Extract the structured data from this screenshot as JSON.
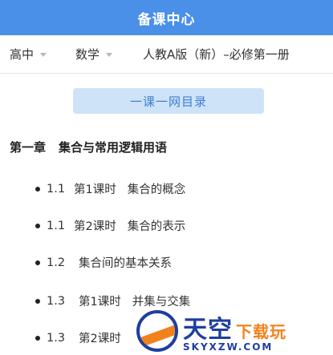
{
  "header": {
    "title": "备课中心"
  },
  "filters": {
    "level": "高中",
    "subject": "数学",
    "textbook": "人教A版（新）–必修第一册"
  },
  "catalog_button": {
    "label": "一课一网目录"
  },
  "chapter": {
    "number": "第一章",
    "title": "集合与常用逻辑用语"
  },
  "lessons": [
    {
      "number": "1.1",
      "period": "第1课时",
      "title": "集合的概念"
    },
    {
      "number": "1.1",
      "period": "第2课时",
      "title": "集合的表示"
    },
    {
      "number": "1.2",
      "period": "",
      "title": "集合间的基本关系"
    },
    {
      "number": "1.3",
      "period": "第1课时",
      "title": "并集与交集"
    },
    {
      "number": "1.3",
      "period": "第2课时",
      "title": ""
    }
  ],
  "watermark": {
    "big_text": "天空",
    "small_text": "下载玩",
    "url": "SKYXZW.COM"
  },
  "colors": {
    "header_bg": "#4a90e8",
    "button_bg": "#cfe3f8",
    "button_text": "#3d7fd4",
    "watermark_blue": "#1f3f9e",
    "watermark_orange": "#f0821e"
  }
}
